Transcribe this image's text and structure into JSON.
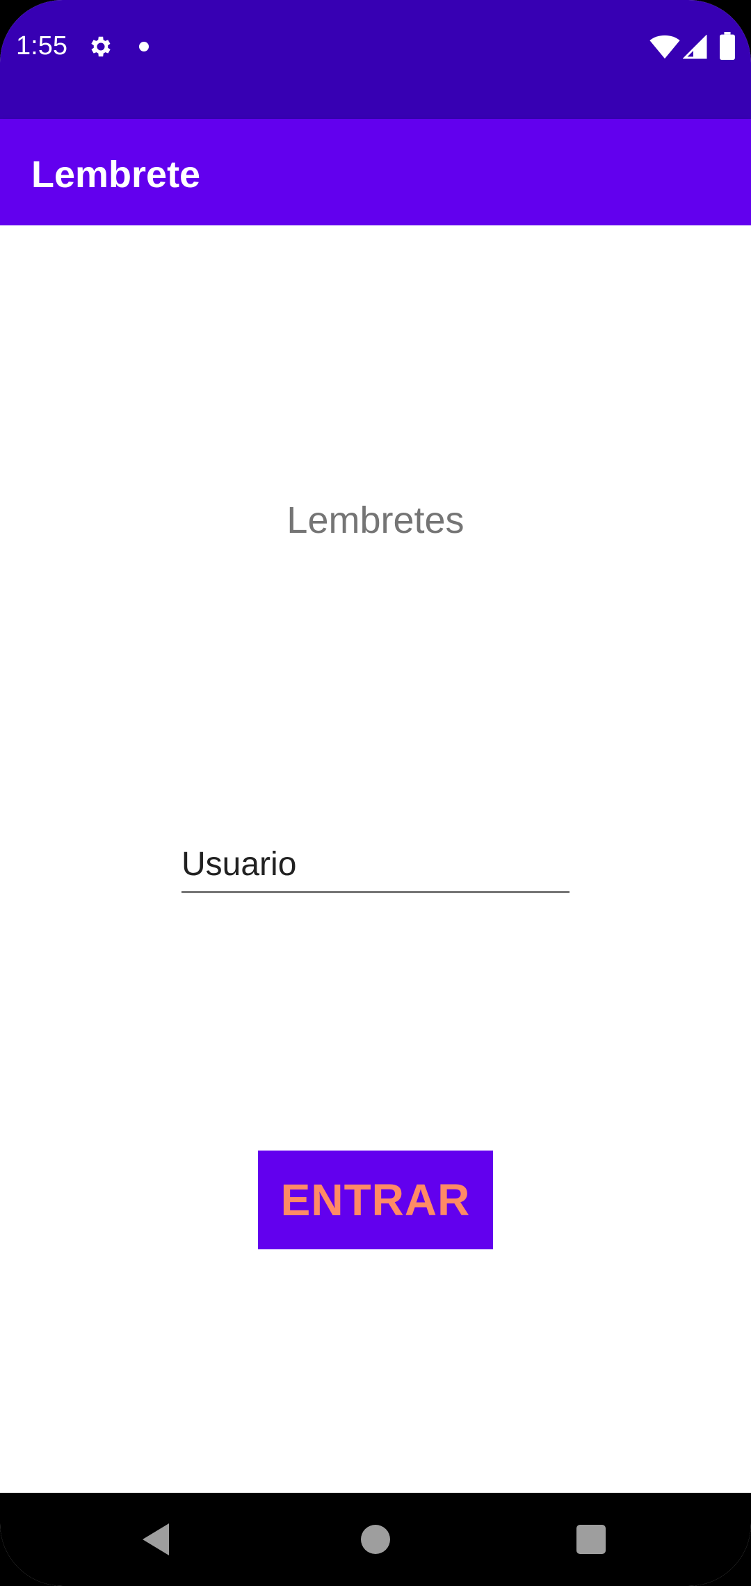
{
  "status_bar": {
    "time": "1:55",
    "icons": [
      "gear-icon",
      "notification-dot-icon",
      "wifi-icon",
      "signal-icon",
      "battery-icon"
    ]
  },
  "app_bar": {
    "title": "Lembrete"
  },
  "main": {
    "heading": "Lembretes",
    "user_field": {
      "placeholder": "Usuario",
      "value": ""
    },
    "enter_button_label": "ENTRAR"
  },
  "nav_bar": {
    "icons": [
      "back-icon",
      "home-icon",
      "recents-icon"
    ]
  },
  "colors": {
    "status_bar": "#3700b3",
    "primary": "#6200ee",
    "button_text": "#ff8a65",
    "heading_text": "#757575"
  }
}
